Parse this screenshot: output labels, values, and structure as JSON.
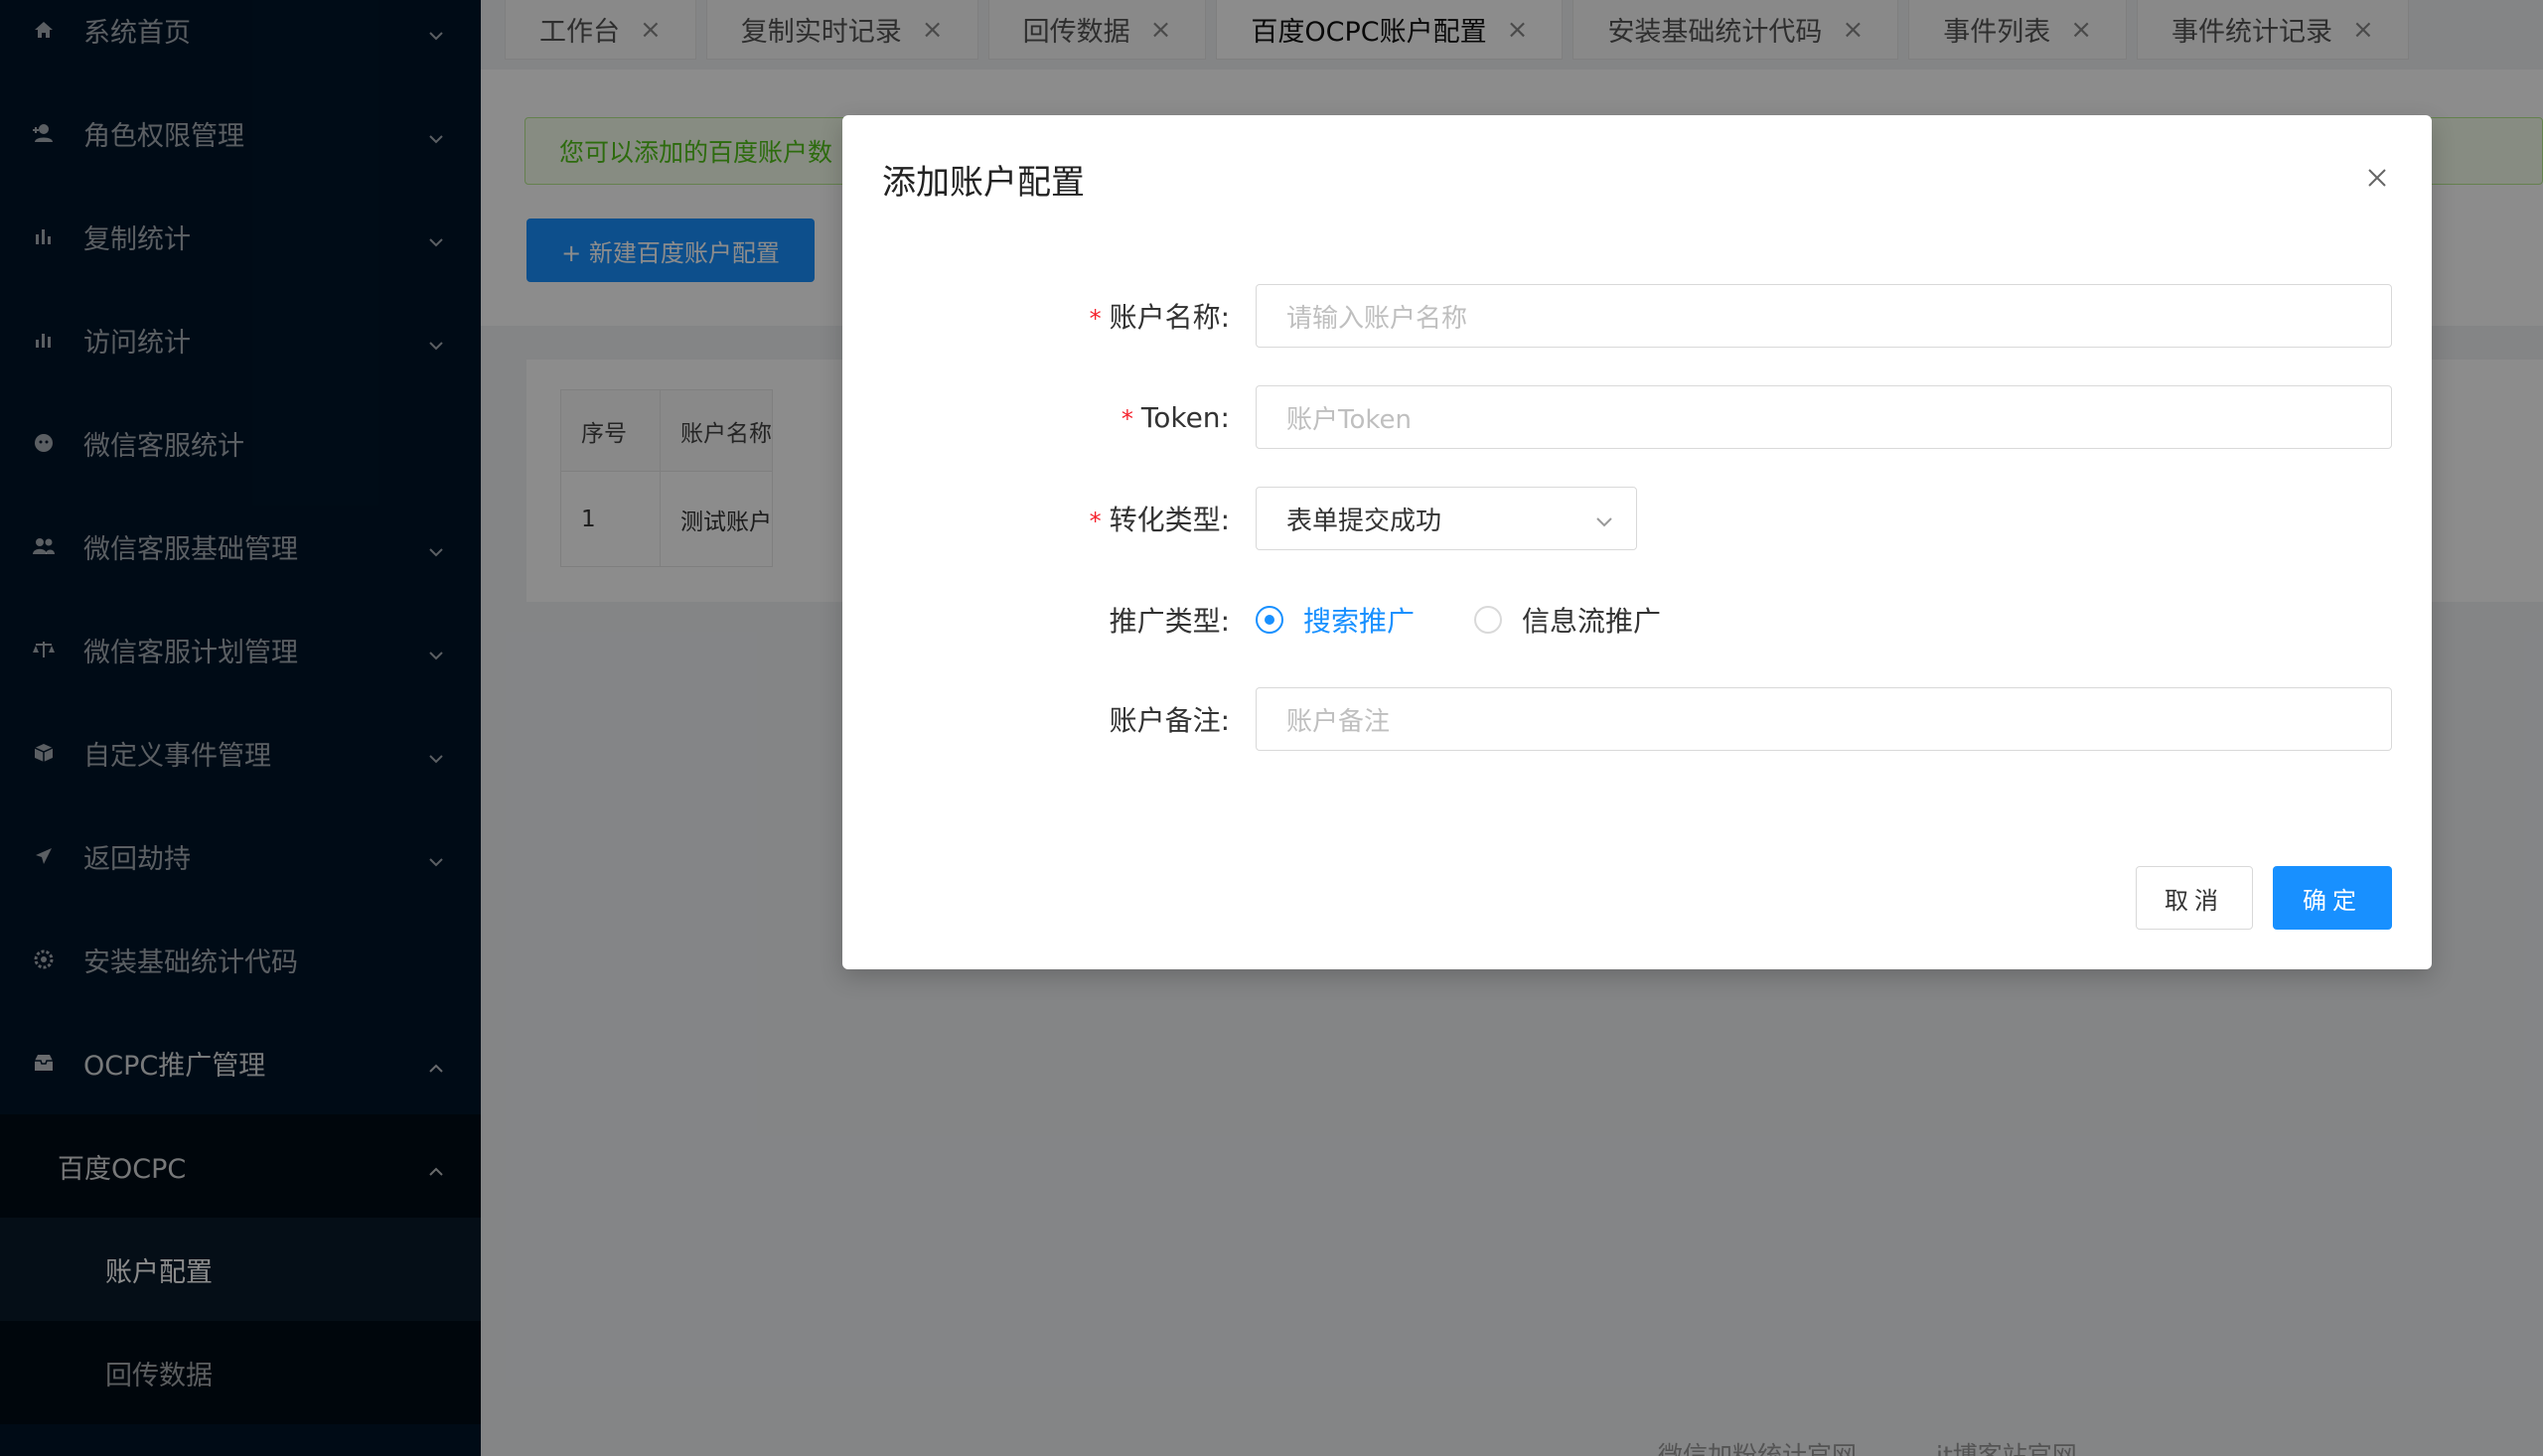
{
  "sidebar": {
    "items": [
      {
        "label": "系统首页",
        "icon": "home-icon"
      },
      {
        "label": "角色权限管理",
        "icon": "user-add-icon"
      },
      {
        "label": "复制统计",
        "icon": "bar-chart-icon"
      },
      {
        "label": "访问统计",
        "icon": "bar-chart-icon"
      },
      {
        "label": "微信客服统计",
        "icon": "wechat-icon"
      },
      {
        "label": "微信客服基础管理",
        "icon": "team-icon"
      },
      {
        "label": "微信客服计划管理",
        "icon": "scale-icon"
      },
      {
        "label": "自定义事件管理",
        "icon": "cube-icon"
      },
      {
        "label": "返回劫持",
        "icon": "send-icon"
      },
      {
        "label": "安装基础统计代码",
        "icon": "gear-icon"
      },
      {
        "label": "OCPC推广管理",
        "icon": "inbox-icon"
      }
    ],
    "sub_parent": "百度OCPC",
    "sub_items": [
      "账户配置",
      "回传数据"
    ]
  },
  "tabs": [
    {
      "label": "工作台"
    },
    {
      "label": "复制实时记录"
    },
    {
      "label": "回传数据"
    },
    {
      "label": "百度OCPC账户配置"
    },
    {
      "label": "安装基础统计代码"
    },
    {
      "label": "事件列表"
    },
    {
      "label": "事件统计记录"
    }
  ],
  "tab_close_glyph": "×",
  "alert_text": "您可以添加的百度账户数",
  "new_button": "+ 新建百度账户配置",
  "table": {
    "headers": [
      "序号",
      "账户名称"
    ],
    "rows": [
      [
        "1",
        "测试账户"
      ]
    ]
  },
  "footer_links": [
    "微信加粉统计官网",
    "it博客站官网"
  ],
  "modal": {
    "title": "添加账户配置",
    "fields": {
      "account_name": {
        "label": "账户名称:",
        "placeholder": "请输入账户名称"
      },
      "token": {
        "label": "Token:",
        "placeholder": "账户Token"
      },
      "conversion_type": {
        "label": "转化类型:",
        "value": "表单提交成功"
      },
      "promo_type": {
        "label": "推广类型:",
        "options": [
          "搜索推广",
          "信息流推广"
        ],
        "selected": "搜索推广"
      },
      "remark": {
        "label": "账户备注:",
        "placeholder": "账户备注"
      }
    },
    "required_mark": "*",
    "cancel": "取消",
    "ok": "确定"
  },
  "colors": {
    "sidebar_bg": "#001529",
    "primary": "#1890ff",
    "required": "#f5222d",
    "success_text": "#52c41a"
  }
}
